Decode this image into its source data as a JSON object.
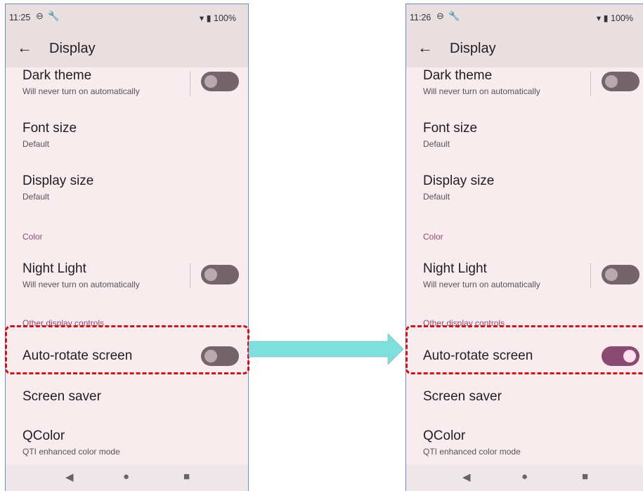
{
  "before": {
    "status": {
      "time": "11:25",
      "battery": "100%"
    },
    "title": "Display",
    "dark_theme": {
      "label": "Dark theme",
      "sub": "Will never turn on automatically"
    },
    "font_size": {
      "label": "Font size",
      "sub": "Default"
    },
    "display_size": {
      "label": "Display size",
      "sub": "Default"
    },
    "section_color": "Color",
    "night_light": {
      "label": "Night Light",
      "sub": "Will never turn on automatically"
    },
    "section_other": "Other display controls",
    "auto_rotate": {
      "label": "Auto-rotate screen",
      "state": "off"
    },
    "screen_saver": {
      "label": "Screen saver"
    },
    "qcolor": {
      "label": "QColor",
      "sub": "QTI enhanced color mode"
    }
  },
  "after": {
    "status": {
      "time": "11:26",
      "battery": "100%"
    },
    "title": "Display",
    "dark_theme": {
      "label": "Dark theme",
      "sub": "Will never turn on automatically"
    },
    "font_size": {
      "label": "Font size",
      "sub": "Default"
    },
    "display_size": {
      "label": "Display size",
      "sub": "Default"
    },
    "section_color": "Color",
    "night_light": {
      "label": "Night Light",
      "sub": "Will never turn on automatically"
    },
    "section_other": "Other display controls",
    "auto_rotate": {
      "label": "Auto-rotate screen",
      "state": "on"
    },
    "screen_saver": {
      "label": "Screen saver"
    },
    "qcolor": {
      "label": "QColor",
      "sub": "QTI enhanced color mode"
    }
  },
  "icons": {
    "sim": "sim-icon",
    "wrench": "wrench-icon",
    "wifi": "wifi-icon",
    "battery": "battery-icon",
    "back": "back-arrow-icon",
    "nav_back": "nav-back-icon",
    "nav_home": "nav-home-icon",
    "nav_recents": "nav-recents-icon"
  },
  "colors": {
    "accent": "#8a4a72",
    "highlight": "#d0121b",
    "arrow": "#7fdfdc",
    "toggle_off": "#736569",
    "background": "#f9ecef",
    "appbar": "#e9dfe1"
  }
}
